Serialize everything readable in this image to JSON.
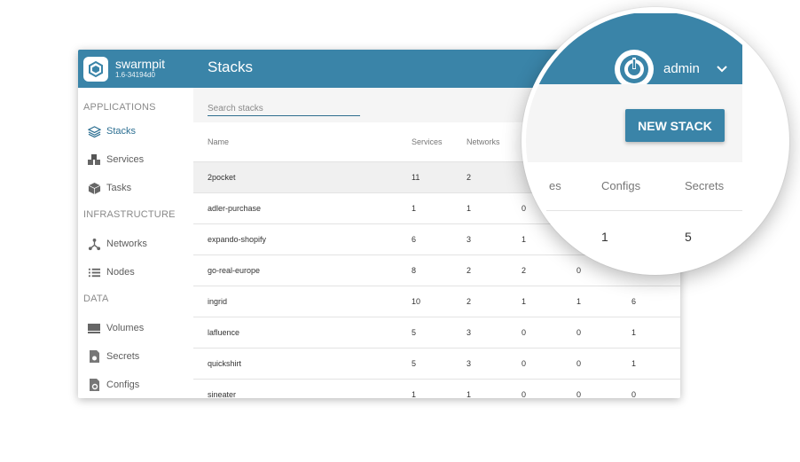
{
  "app": {
    "name": "swarmpit",
    "version": "1.6-34194d0"
  },
  "page_title": "Stacks",
  "sidebar": {
    "sections": [
      {
        "title": "APPLICATIONS",
        "items": [
          {
            "label": "Stacks",
            "icon": "stacks-icon",
            "active": true
          },
          {
            "label": "Services",
            "icon": "services-icon"
          },
          {
            "label": "Tasks",
            "icon": "tasks-icon"
          }
        ]
      },
      {
        "title": "INFRASTRUCTURE",
        "items": [
          {
            "label": "Networks",
            "icon": "networks-icon"
          },
          {
            "label": "Nodes",
            "icon": "nodes-icon"
          }
        ]
      },
      {
        "title": "DATA",
        "items": [
          {
            "label": "Volumes",
            "icon": "volumes-icon"
          },
          {
            "label": "Secrets",
            "icon": "secrets-icon"
          },
          {
            "label": "Configs",
            "icon": "configs-icon"
          }
        ]
      }
    ]
  },
  "search": {
    "placeholder": "Search stacks",
    "value": ""
  },
  "table": {
    "headers": [
      "Name",
      "Services",
      "Networks"
    ],
    "rows": [
      [
        "2pocket",
        "11",
        "2",
        "",
        "",
        ""
      ],
      [
        "adler-purchase",
        "1",
        "1",
        "0",
        "",
        ""
      ],
      [
        "expando-shopify",
        "6",
        "3",
        "1",
        "",
        ""
      ],
      [
        "go-real-europe",
        "8",
        "2",
        "2",
        "0",
        ""
      ],
      [
        "ingrid",
        "10",
        "2",
        "1",
        "1",
        "6"
      ],
      [
        "lafluence",
        "5",
        "3",
        "0",
        "0",
        "1"
      ],
      [
        "quickshirt",
        "5",
        "3",
        "0",
        "0",
        "1"
      ],
      [
        "sineater",
        "1",
        "1",
        "0",
        "0",
        "0"
      ]
    ]
  },
  "zoom": {
    "user": "admin",
    "new_stack_label": "NEW STACK",
    "partial_header": "es",
    "headers": [
      "Configs",
      "Secrets"
    ],
    "values": [
      "1",
      "5"
    ]
  },
  "colors": {
    "primary": "#3a84a8",
    "sidebar_active": "#2c6f92"
  }
}
